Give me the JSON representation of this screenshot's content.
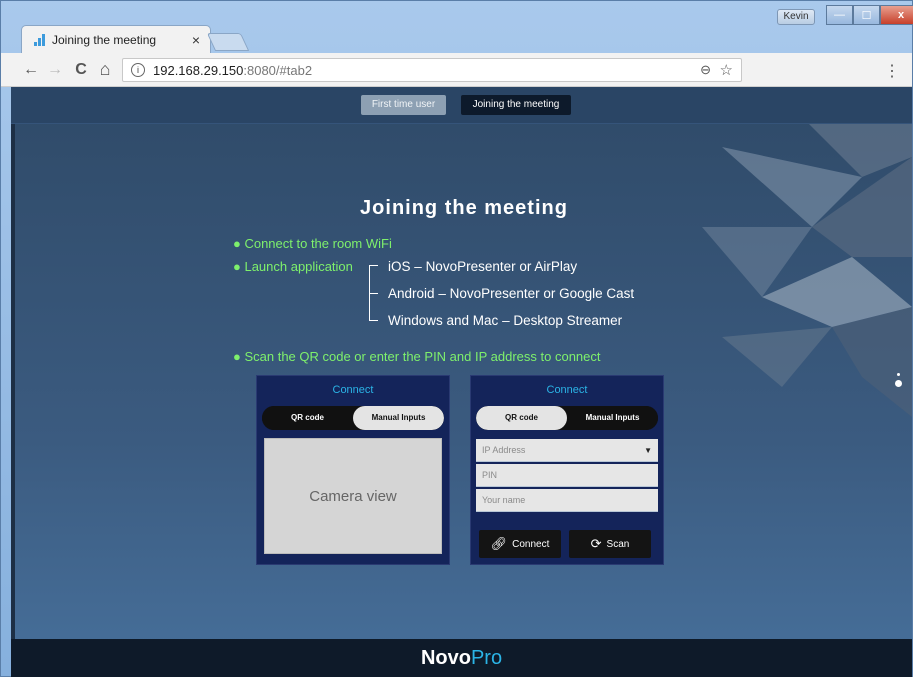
{
  "browser": {
    "tab_title": "Joining the meeting",
    "tab_close": "×",
    "url_host": "192.168.29.150",
    "url_path": ":8080/#tab2",
    "profile": "Kevin",
    "back": "←",
    "forward": "→",
    "reload": "C",
    "home": "⌂",
    "zoom": "⊖",
    "star": "☆",
    "menu": "⋮",
    "info": "i",
    "win_min": "—",
    "win_max": "☐",
    "win_close": "x"
  },
  "nav": {
    "first_time_user": "First time user",
    "joining_meeting": "Joining the meeting"
  },
  "main": {
    "heading": "Joining the meeting",
    "bullets": {
      "wifi": "● Connect to the room WiFi",
      "launch": "● Launch application",
      "scan": "● Scan the QR code or enter the PIN and IP address to connect"
    },
    "apps": {
      "ios_platform": "iOS",
      "ios_apps": "NovoPresenter or AirPlay",
      "android_platform": "Android",
      "android_apps": "NovoPresenter or Google Cast",
      "win_platform": "Windows and Mac",
      "win_apps": "Desktop Streamer",
      "dash": "–"
    }
  },
  "left_panel": {
    "title": "Connect",
    "qr_label": "QR code",
    "manual_label": "Manual Inputs",
    "camera_view": "Camera view"
  },
  "right_panel": {
    "title": "Connect",
    "qr_label": "QR code",
    "manual_label": "Manual Inputs",
    "ip_placeholder": "IP Address",
    "pin_placeholder": "PIN",
    "name_placeholder": "Your name",
    "connect_label": "Connect",
    "scan_label": "Scan"
  },
  "footer": {
    "brand_bold": "Novo",
    "brand_light": "Pro"
  },
  "colors": {
    "accent_green": "#7ef06c",
    "accent_blue": "#2bb4e6",
    "panel_bg": "#14245a"
  }
}
